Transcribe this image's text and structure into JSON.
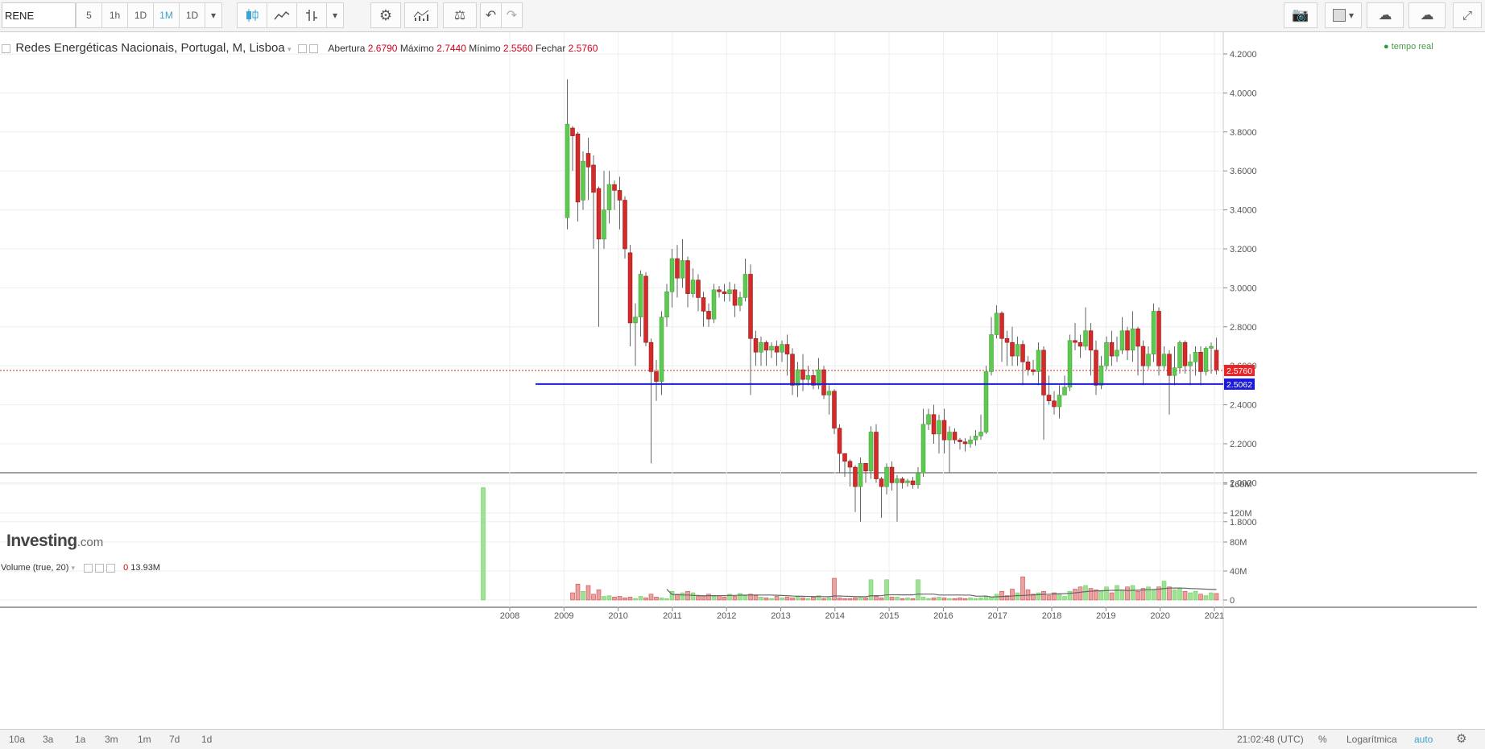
{
  "toolbar": {
    "symbol": "RENE",
    "intervals": [
      "5",
      "1h",
      "1D",
      "1M",
      "1D"
    ],
    "active_interval": "1M"
  },
  "legend": {
    "title": "Redes Energéticas Nacionais, Portugal, M, Lisboa",
    "open_label": "Abertura",
    "open_value": "2.6790",
    "high_label": "Máximo",
    "high_value": "2.7440",
    "low_label": "Mínimo",
    "low_value": "2.5560",
    "close_label": "Fechar",
    "close_value": "2.5760",
    "realtime": "tempo real"
  },
  "watermark": {
    "brand": "Investing",
    "suffix": ".com"
  },
  "volume_legend": {
    "label": "Volume (true, 20)",
    "value1": "0",
    "value2": "13.93M"
  },
  "price_labels": {
    "last": "2.5760",
    "hline": "2.5062"
  },
  "bottombar": {
    "ranges": [
      "10a",
      "3a",
      "1a",
      "3m",
      "1m",
      "7d",
      "1d"
    ],
    "time": "21:02:48 (UTC)",
    "percent": "%",
    "log": "Logarítmica",
    "auto": "auto"
  },
  "colors": {
    "up": "#5ec950",
    "down": "#d32a2a",
    "hline": "#1a1ad8",
    "last": "#e8262a"
  },
  "chart_data": [
    {
      "type": "candlestick",
      "title": "Redes Energéticas Nacionais, Portugal, M, Lisboa",
      "x_ticks": [
        "2008",
        "2009",
        "2010",
        "2011",
        "2012",
        "2013",
        "2014",
        "2015",
        "2016",
        "2017",
        "2018",
        "2019",
        "2020",
        "2021"
      ],
      "y_ticks": [
        "4.2000",
        "4.0000",
        "3.8000",
        "3.6000",
        "3.4000",
        "3.2000",
        "3.0000",
        "2.8000",
        "2.6000",
        "2.4000",
        "2.2000",
        "2.0000",
        "1.8000"
      ],
      "ylim": [
        1.75,
        4.25
      ],
      "candles": [
        [
          3.36,
          3.84,
          3.3,
          4.07
        ],
        [
          3.82,
          3.78,
          3.6,
          3.83
        ],
        [
          3.79,
          3.44,
          3.34,
          3.8
        ],
        [
          3.45,
          3.65,
          3.4,
          3.7
        ],
        [
          3.69,
          3.62,
          3.45,
          3.77
        ],
        [
          3.63,
          3.49,
          3.2,
          3.68
        ],
        [
          3.51,
          3.25,
          2.8,
          3.52
        ],
        [
          3.25,
          3.4,
          3.2,
          3.6
        ],
        [
          3.4,
          3.53,
          3.33,
          3.6
        ],
        [
          3.53,
          3.5,
          3.4,
          3.55
        ],
        [
          3.5,
          3.45,
          3.3,
          3.57
        ],
        [
          3.45,
          3.2,
          3.15,
          3.47
        ],
        [
          3.18,
          2.82,
          2.7,
          3.22
        ],
        [
          2.82,
          2.85,
          2.6,
          2.92
        ],
        [
          2.85,
          3.07,
          2.75,
          3.09
        ],
        [
          3.06,
          2.72,
          2.7,
          3.08
        ],
        [
          2.72,
          2.57,
          2.1,
          2.74
        ],
        [
          2.57,
          2.52,
          2.42,
          2.63
        ],
        [
          2.52,
          2.85,
          2.45,
          2.88
        ],
        [
          2.85,
          2.98,
          2.8,
          3.02
        ],
        [
          2.98,
          3.15,
          2.9,
          3.2
        ],
        [
          3.15,
          3.05,
          2.95,
          3.22
        ],
        [
          3.05,
          3.14,
          3.0,
          3.25
        ],
        [
          3.14,
          2.97,
          2.9,
          3.16
        ],
        [
          2.97,
          3.04,
          2.95,
          3.1
        ],
        [
          3.04,
          2.95,
          2.88,
          3.07
        ],
        [
          2.95,
          2.88,
          2.8,
          2.98
        ],
        [
          2.88,
          2.84,
          2.8,
          2.92
        ],
        [
          2.84,
          2.99,
          2.82,
          3.02
        ],
        [
          2.99,
          2.98,
          2.95,
          3.01
        ],
        [
          2.98,
          2.97,
          2.93,
          3.02
        ],
        [
          2.97,
          2.99,
          2.93,
          3.03
        ],
        [
          2.99,
          2.91,
          2.85,
          3.02
        ],
        [
          2.91,
          2.95,
          2.88,
          2.98
        ],
        [
          2.95,
          3.07,
          2.93,
          3.15
        ],
        [
          3.07,
          2.74,
          2.45,
          3.12
        ],
        [
          2.74,
          2.67,
          2.6,
          2.78
        ],
        [
          2.67,
          2.72,
          2.6,
          2.75
        ],
        [
          2.72,
          2.68,
          2.6,
          2.73
        ],
        [
          2.68,
          2.7,
          2.64,
          2.72
        ],
        [
          2.7,
          2.67,
          2.6,
          2.73
        ],
        [
          2.67,
          2.71,
          2.62,
          2.73
        ],
        [
          2.71,
          2.66,
          2.55,
          2.76
        ],
        [
          2.66,
          2.5,
          2.45,
          2.69
        ],
        [
          2.5,
          2.58,
          2.44,
          2.62
        ],
        [
          2.58,
          2.53,
          2.47,
          2.66
        ],
        [
          2.53,
          2.55,
          2.5,
          2.6
        ],
        [
          2.55,
          2.5,
          2.48,
          2.58
        ],
        [
          2.5,
          2.58,
          2.48,
          2.64
        ],
        [
          2.58,
          2.45,
          2.43,
          2.6
        ],
        [
          2.45,
          2.47,
          2.35,
          2.5
        ],
        [
          2.47,
          2.28,
          2.25,
          2.48
        ],
        [
          2.28,
          2.15,
          2.05,
          2.3
        ],
        [
          2.15,
          2.11,
          2.03,
          2.15
        ],
        [
          2.11,
          2.08,
          1.98,
          2.12
        ],
        [
          2.08,
          1.98,
          1.85,
          2.09
        ],
        [
          1.98,
          2.1,
          1.8,
          2.13
        ],
        [
          2.1,
          2.06,
          2.0,
          2.1
        ],
        [
          2.06,
          2.26,
          2.02,
          2.29
        ],
        [
          2.26,
          2.02,
          2.0,
          2.3
        ],
        [
          2.02,
          1.98,
          1.82,
          2.03
        ],
        [
          1.98,
          2.08,
          1.94,
          2.1
        ],
        [
          2.08,
          2.0,
          1.96,
          2.11
        ],
        [
          2.0,
          2.02,
          1.8,
          2.04
        ],
        [
          2.02,
          2.0,
          1.97,
          2.03
        ],
        [
          2.0,
          2.01,
          1.98,
          2.02
        ],
        [
          2.01,
          1.99,
          1.97,
          2.03
        ],
        [
          1.99,
          2.05,
          1.97,
          2.08
        ],
        [
          2.05,
          2.3,
          2.03,
          2.38
        ],
        [
          2.3,
          2.35,
          2.27,
          2.38
        ],
        [
          2.35,
          2.25,
          2.2,
          2.4
        ],
        [
          2.25,
          2.32,
          2.15,
          2.35
        ],
        [
          2.32,
          2.22,
          2.15,
          2.38
        ],
        [
          2.22,
          2.26,
          2.05,
          2.29
        ],
        [
          2.26,
          2.22,
          2.2,
          2.28
        ],
        [
          2.22,
          2.21,
          2.17,
          2.23
        ],
        [
          2.21,
          2.2,
          2.16,
          2.23
        ],
        [
          2.2,
          2.22,
          2.18,
          2.24
        ],
        [
          2.22,
          2.24,
          2.19,
          2.27
        ],
        [
          2.24,
          2.26,
          2.22,
          2.35
        ],
        [
          2.26,
          2.57,
          2.25,
          2.6
        ],
        [
          2.57,
          2.76,
          2.55,
          2.85
        ],
        [
          2.76,
          2.87,
          2.74,
          2.91
        ],
        [
          2.87,
          2.74,
          2.62,
          2.88
        ],
        [
          2.74,
          2.72,
          2.6,
          2.78
        ],
        [
          2.72,
          2.65,
          2.6,
          2.8
        ],
        [
          2.65,
          2.71,
          2.6,
          2.75
        ],
        [
          2.71,
          2.62,
          2.5,
          2.73
        ],
        [
          2.62,
          2.58,
          2.55,
          2.65
        ],
        [
          2.58,
          2.57,
          2.55,
          2.63
        ],
        [
          2.57,
          2.68,
          2.5,
          2.72
        ],
        [
          2.68,
          2.45,
          2.22,
          2.7
        ],
        [
          2.45,
          2.42,
          2.4,
          2.55
        ],
        [
          2.42,
          2.39,
          2.35,
          2.47
        ],
        [
          2.39,
          2.45,
          2.33,
          2.5
        ],
        [
          2.45,
          2.49,
          2.45,
          2.55
        ],
        [
          2.49,
          2.73,
          2.47,
          2.76
        ],
        [
          2.73,
          2.72,
          2.68,
          2.82
        ],
        [
          2.72,
          2.7,
          2.64,
          2.76
        ],
        [
          2.7,
          2.78,
          2.68,
          2.9
        ],
        [
          2.78,
          2.68,
          2.55,
          2.82
        ],
        [
          2.68,
          2.5,
          2.45,
          2.73
        ],
        [
          2.5,
          2.6,
          2.48,
          2.65
        ],
        [
          2.6,
          2.72,
          2.58,
          2.75
        ],
        [
          2.72,
          2.65,
          2.6,
          2.78
        ],
        [
          2.65,
          2.68,
          2.62,
          2.75
        ],
        [
          2.68,
          2.78,
          2.66,
          2.85
        ],
        [
          2.78,
          2.68,
          2.63,
          2.8
        ],
        [
          2.68,
          2.79,
          2.62,
          2.88
        ],
        [
          2.79,
          2.7,
          2.55,
          2.8
        ],
        [
          2.7,
          2.6,
          2.5,
          2.73
        ],
        [
          2.6,
          2.66,
          2.58,
          2.7
        ],
        [
          2.66,
          2.88,
          2.62,
          2.92
        ],
        [
          2.88,
          2.6,
          2.55,
          2.9
        ],
        [
          2.6,
          2.66,
          2.58,
          2.7
        ],
        [
          2.66,
          2.55,
          2.35,
          2.68
        ],
        [
          2.55,
          2.59,
          2.5,
          2.7
        ],
        [
          2.59,
          2.72,
          2.56,
          2.73
        ],
        [
          2.72,
          2.6,
          2.56,
          2.73
        ],
        [
          2.6,
          2.62,
          2.5,
          2.66
        ],
        [
          2.62,
          2.67,
          2.55,
          2.7
        ],
        [
          2.67,
          2.57,
          2.5,
          2.7
        ],
        [
          2.57,
          2.69,
          2.55,
          2.7
        ],
        [
          2.69,
          2.7,
          2.56,
          2.72
        ],
        [
          2.68,
          2.58,
          2.556,
          2.744
        ]
      ]
    },
    {
      "type": "bar",
      "series_label": "Volume (true, 20)",
      "y_ticks": [
        "160M",
        "120M",
        "80M",
        "40M",
        "0"
      ],
      "ylim": [
        0,
        170
      ],
      "values": [
        155,
        10,
        22,
        12,
        20,
        8,
        14,
        5,
        6,
        4,
        5,
        3,
        4,
        2,
        5,
        3,
        8,
        4,
        3,
        2,
        12,
        8,
        10,
        12,
        10,
        5,
        6,
        8,
        5,
        6,
        4,
        8,
        5,
        9,
        6,
        8,
        6,
        4,
        3,
        2,
        5,
        3,
        4,
        3,
        5,
        3,
        2,
        4,
        6,
        2,
        3,
        30,
        3,
        2,
        2,
        3,
        4,
        3,
        28,
        5,
        3,
        28,
        4,
        4,
        2,
        3,
        2,
        28,
        4,
        2,
        3,
        4,
        3,
        2,
        2,
        3,
        2,
        3,
        2,
        3,
        5,
        4,
        8,
        12,
        6,
        15,
        10,
        32,
        14,
        8,
        10,
        12,
        6,
        10,
        8,
        5,
        12,
        15,
        18,
        20,
        16,
        14,
        12,
        18,
        10,
        20,
        14,
        18,
        20,
        12,
        16,
        18,
        14,
        18,
        26,
        18,
        14,
        16,
        12,
        10,
        12,
        8,
        6,
        10,
        9
      ]
    }
  ]
}
